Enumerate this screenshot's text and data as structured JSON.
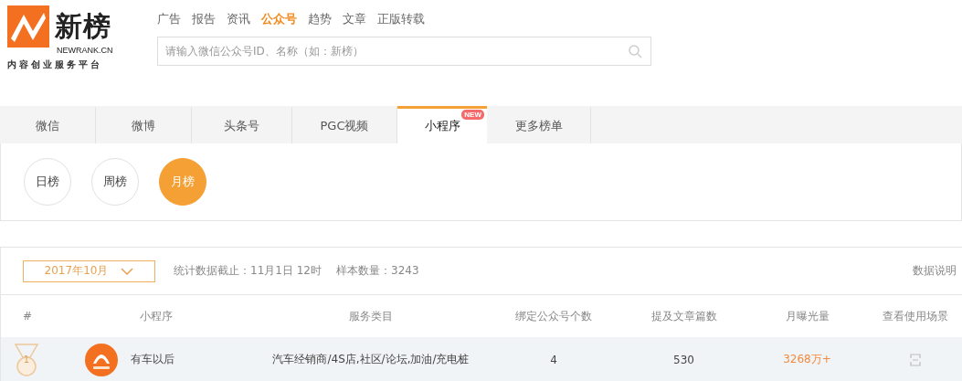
{
  "logo": {
    "name": "新榜",
    "domain": "NEWRANK.CN",
    "slogan": "内容创业服务平台"
  },
  "nav": [
    {
      "label": "广告",
      "selected": false
    },
    {
      "label": "报告",
      "selected": false
    },
    {
      "label": "资讯",
      "selected": false
    },
    {
      "label": "公众号",
      "selected": true
    },
    {
      "label": "趋势",
      "selected": false
    },
    {
      "label": "文章",
      "selected": false
    },
    {
      "label": "正版转载",
      "selected": false
    }
  ],
  "search": {
    "placeholder": "请输入微信公众号ID、名称（如：新榜）"
  },
  "tabs": [
    {
      "label": "微信",
      "selected": false
    },
    {
      "label": "微博",
      "selected": false
    },
    {
      "label": "头条号",
      "selected": false
    },
    {
      "label": "PGC视频",
      "selected": false
    },
    {
      "label": "小程序",
      "selected": true,
      "badge": "NEW"
    },
    {
      "label": "更多榜单",
      "selected": false
    }
  ],
  "periods": [
    {
      "label": "日榜",
      "selected": false
    },
    {
      "label": "周榜",
      "selected": false
    },
    {
      "label": "月榜",
      "selected": true
    }
  ],
  "filter": {
    "month": "2017年10月",
    "cutoff": "统计数据截止：11月1日 12时",
    "sample": "样本数量：3243",
    "help": "数据说明"
  },
  "table": {
    "columns": [
      "#",
      "小程序",
      "服务类目",
      "绑定公众号个数",
      "提及文章篇数",
      "月曝光量",
      "查看使用场景"
    ],
    "rows": [
      {
        "rank": "1",
        "name": "有车以后",
        "category": "汽车经销商/4S店,社区/论坛,加油/充电桩",
        "accounts": "4",
        "articles": "530",
        "exposure": "3268万+"
      }
    ]
  }
}
